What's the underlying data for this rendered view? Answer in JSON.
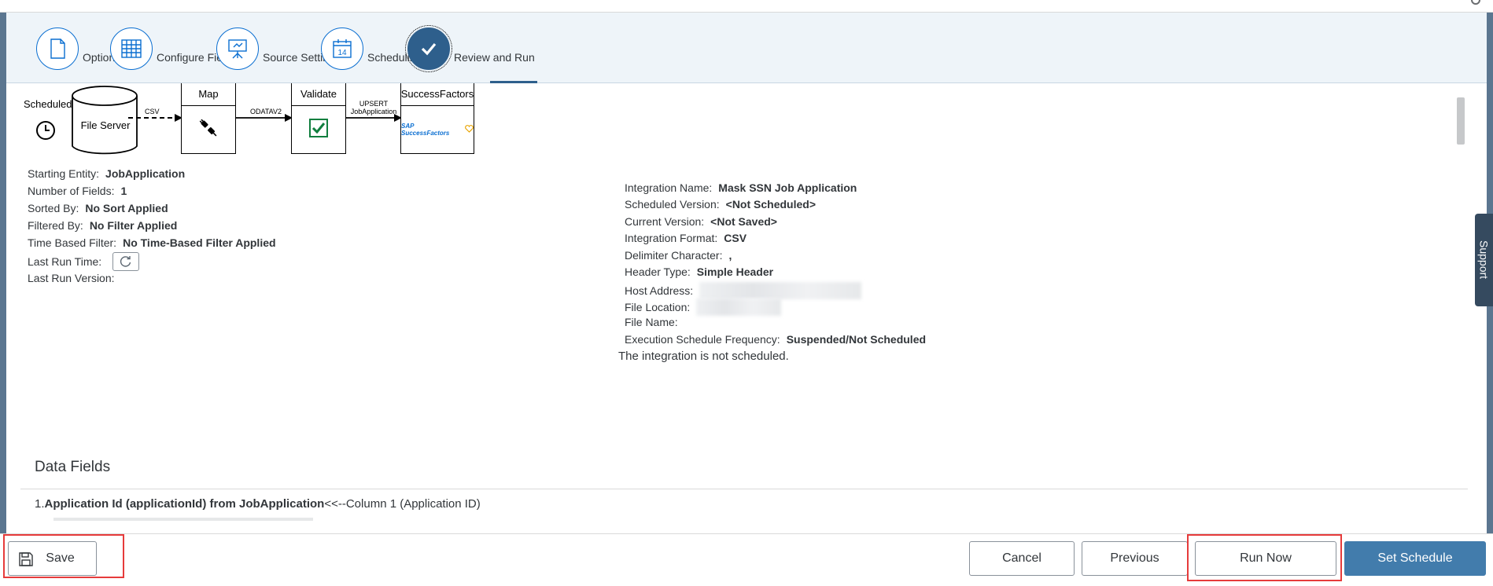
{
  "wizard": {
    "steps": [
      {
        "label": "Options",
        "icon": "document-icon"
      },
      {
        "label": "Configure Fields",
        "icon": "table-grid-icon"
      },
      {
        "label": "Source Settings",
        "icon": "presentation-board-icon"
      },
      {
        "label": "Scheduling",
        "icon": "calendar-icon",
        "icon_text": "14"
      },
      {
        "label": "Review and Run",
        "icon": "checkmark-icon",
        "active": true
      }
    ]
  },
  "flow": {
    "trigger_label": "Scheduled",
    "source_label": "File Server",
    "edge1_label": "CSV",
    "map_label": "Map",
    "edge2_label": "ODATAV2",
    "validate_label": "Validate",
    "edge3_line1": "UPSERT",
    "edge3_line2": "JobApplication",
    "target_label": "SuccessFactors",
    "target_logo_text": "SAP SuccessFactors"
  },
  "summary_left": [
    {
      "label": "Starting Entity:",
      "value": "JobApplication"
    },
    {
      "label": "Number of Fields:",
      "value": "1"
    },
    {
      "label": "Sorted By:",
      "value": "No Sort Applied"
    },
    {
      "label": "Filtered By:",
      "value": "No Filter Applied"
    },
    {
      "label": "Time Based Filter:",
      "value": "No Time-Based Filter Applied"
    },
    {
      "label": "Last Run Time:",
      "value": ""
    },
    {
      "label": "Last Run Version:",
      "value": ""
    }
  ],
  "summary_right": [
    {
      "label": "Integration Name:",
      "value": "Mask SSN Job Application"
    },
    {
      "label": "Scheduled Version:",
      "value": "<Not Scheduled>"
    },
    {
      "label": "Current Version:",
      "value": "<Not Saved>"
    },
    {
      "label": "Integration Format:",
      "value": "CSV"
    },
    {
      "label": "Delimiter Character:",
      "value": ","
    },
    {
      "label": "Header Type:",
      "value": "Simple Header"
    },
    {
      "label": "Host Address:",
      "value": ""
    },
    {
      "label": "File Location:",
      "value": ""
    },
    {
      "label": "File Name:",
      "value": ""
    },
    {
      "label": "Execution Schedule Frequency:",
      "value": "Suspended/Not Scheduled"
    }
  ],
  "schedule_note": "The integration is not scheduled.",
  "data_fields": {
    "title": "Data Fields",
    "rows": [
      {
        "index": "1.",
        "name": "Application Id (applicationId) from JobApplication",
        "mapping": "<<--Column 1 (Application ID)"
      }
    ]
  },
  "footer": {
    "save_label": "Save",
    "cancel_label": "Cancel",
    "previous_label": "Previous",
    "run_now_label": "Run Now",
    "set_schedule_label": "Set Schedule"
  },
  "support_label": "Support",
  "colors": {
    "accent": "#0a6ed1",
    "active_step": "#2e5f8c",
    "primary_button": "#427cac",
    "highlight": "#e63b3b",
    "validate_green": "#107e3e"
  }
}
